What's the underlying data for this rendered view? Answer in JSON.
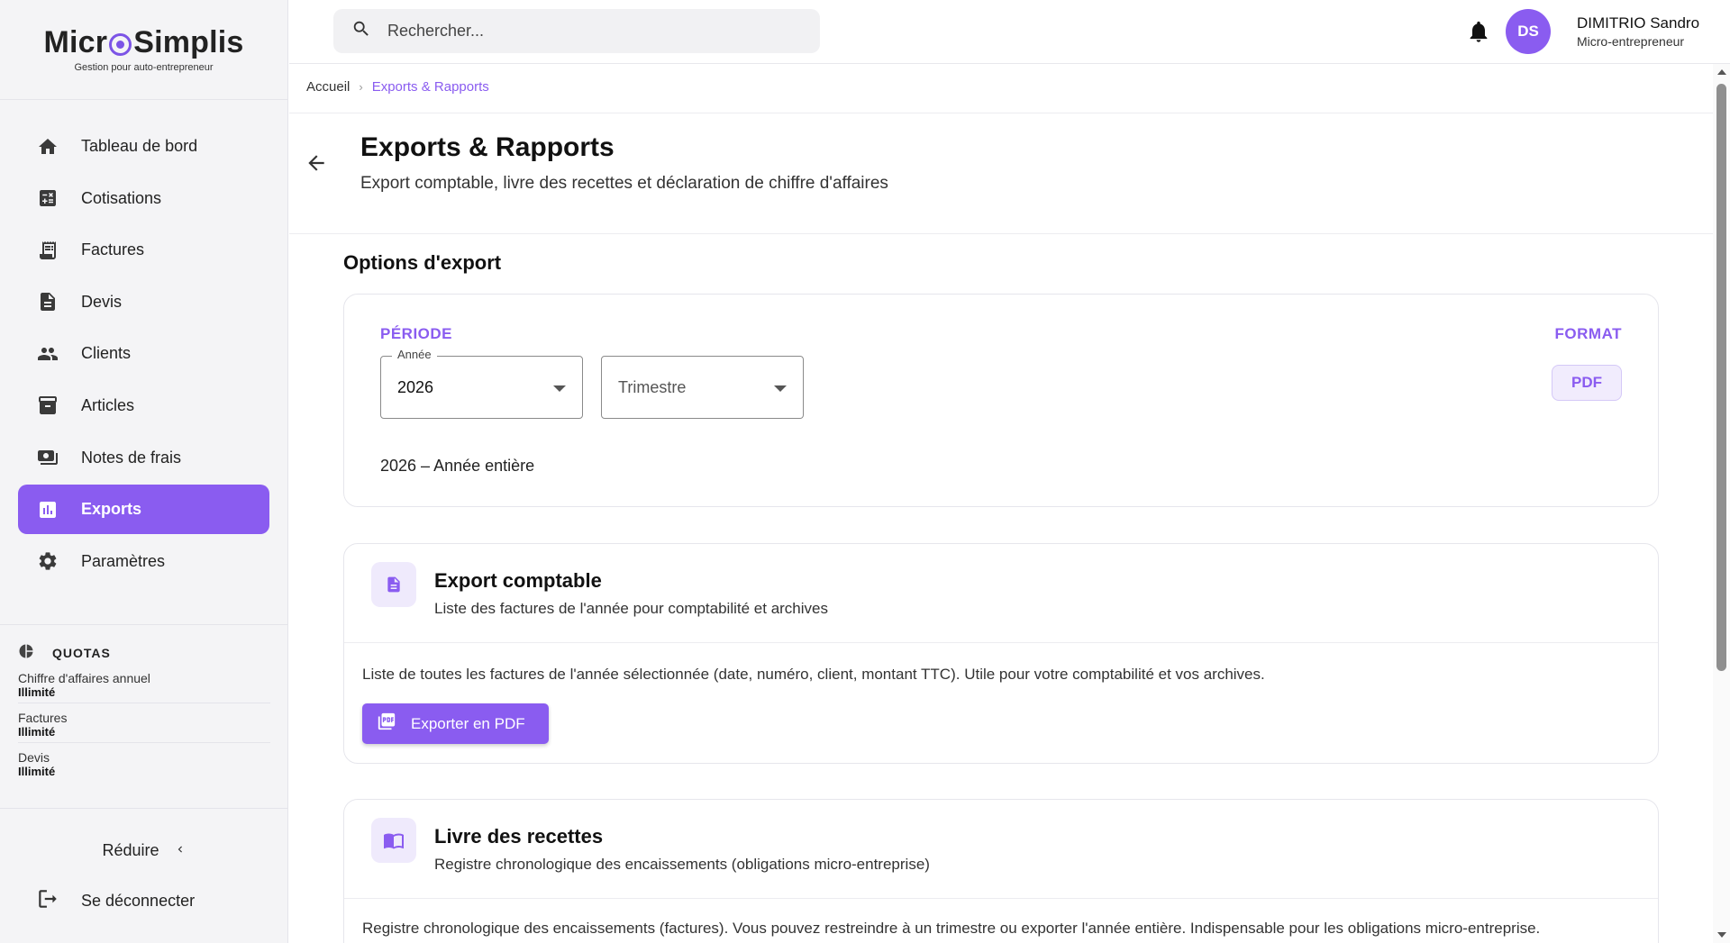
{
  "brand": {
    "logo_left": "Micr",
    "logo_right": "Simplis",
    "tagline": "Gestion pour auto-entrepreneur",
    "accent_color": "#8a5cf0"
  },
  "sidebar": {
    "items": [
      {
        "label": "Tableau de bord",
        "icon": "home-icon"
      },
      {
        "label": "Cotisations",
        "icon": "calculator-icon"
      },
      {
        "label": "Factures",
        "icon": "receipt-icon"
      },
      {
        "label": "Devis",
        "icon": "document-icon"
      },
      {
        "label": "Clients",
        "icon": "people-icon"
      },
      {
        "label": "Articles",
        "icon": "archive-icon"
      },
      {
        "label": "Notes de frais",
        "icon": "money-icon"
      },
      {
        "label": "Exports",
        "icon": "bar-chart-icon",
        "active": true
      },
      {
        "label": "Paramètres",
        "icon": "gear-icon"
      }
    ],
    "quotas": {
      "title": "QUOTAS",
      "rows": [
        {
          "label": "Chiffre d'affaires annuel",
          "value": "Illimité"
        },
        {
          "label": "Factures",
          "value": "Illimité"
        },
        {
          "label": "Devis",
          "value": "Illimité"
        }
      ]
    },
    "reduce_label": "Réduire",
    "logout_label": "Se déconnecter"
  },
  "topbar": {
    "search_placeholder": "Rechercher...",
    "avatar_initials": "DS",
    "user_name": "DIMITRIO Sandro",
    "user_role": "Micro-entrepreneur"
  },
  "breadcrumb": {
    "home": "Accueil",
    "separator": "›",
    "current": "Exports & Rapports"
  },
  "page": {
    "title": "Exports & Rapports",
    "subtitle": "Export comptable, livre des recettes et déclaration de chiffre d'affaires"
  },
  "options": {
    "section_title": "Options d'export",
    "periode_label": "PÉRIODE",
    "format_label": "FORMAT",
    "year_legend": "Année",
    "year_value": "2026",
    "quarter_placeholder": "Trimestre",
    "format_value": "PDF",
    "period_summary": "2026 – Année entière"
  },
  "export_comptable": {
    "title": "Export comptable",
    "subtitle": "Liste des factures de l'année pour comptabilité et archives",
    "description": "Liste de toutes les factures de l'année sélectionnée (date, numéro, client, montant TTC). Utile pour votre comptabilité et vos archives.",
    "button_label": "Exporter en PDF"
  },
  "livre_recettes": {
    "title": "Livre des recettes",
    "subtitle": "Registre chronologique des encaissements (obligations micro-entreprise)",
    "description": "Registre chronologique des encaissements (factures). Vous pouvez restreindre à un trimestre ou exporter l'année entière. Indispensable pour les obligations micro-entreprise."
  }
}
